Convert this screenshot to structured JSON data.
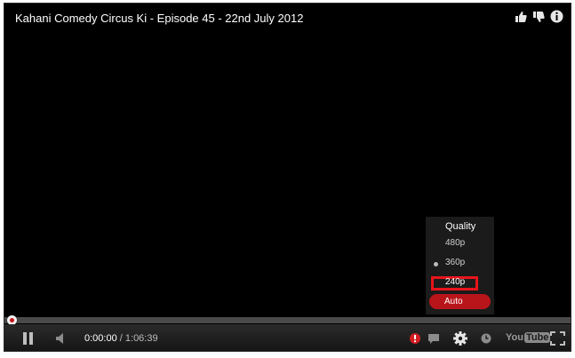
{
  "video": {
    "title": "Kahani Comedy Circus Ki - Episode 45 - 22nd July 2012"
  },
  "top_icons": [
    "thumbs-up-icon",
    "thumbs-down-icon",
    "info-icon"
  ],
  "quality_menu": {
    "title": "Quality",
    "options": [
      {
        "label": "480p"
      },
      {
        "label": "360p",
        "playing": true
      },
      {
        "label": "240p",
        "highlighted": true
      },
      {
        "label": "Auto",
        "selected": true
      }
    ]
  },
  "playback": {
    "current_time": "0:00:00",
    "separator": "/",
    "duration": "1:06:39",
    "progress": 0
  },
  "controls": {
    "icons": [
      "pause-icon",
      "volume-icon",
      "alert-icon",
      "captions-icon",
      "gear-icon",
      "watch-later-icon",
      "fullscreen-icon"
    ],
    "logo_you": "You",
    "logo_tube": "Tube"
  },
  "colors": {
    "player_bg": "#000000",
    "accent_red": "#b8151b",
    "highlight_red": "#e8141c",
    "menu_bg": "#1b1b1b"
  }
}
